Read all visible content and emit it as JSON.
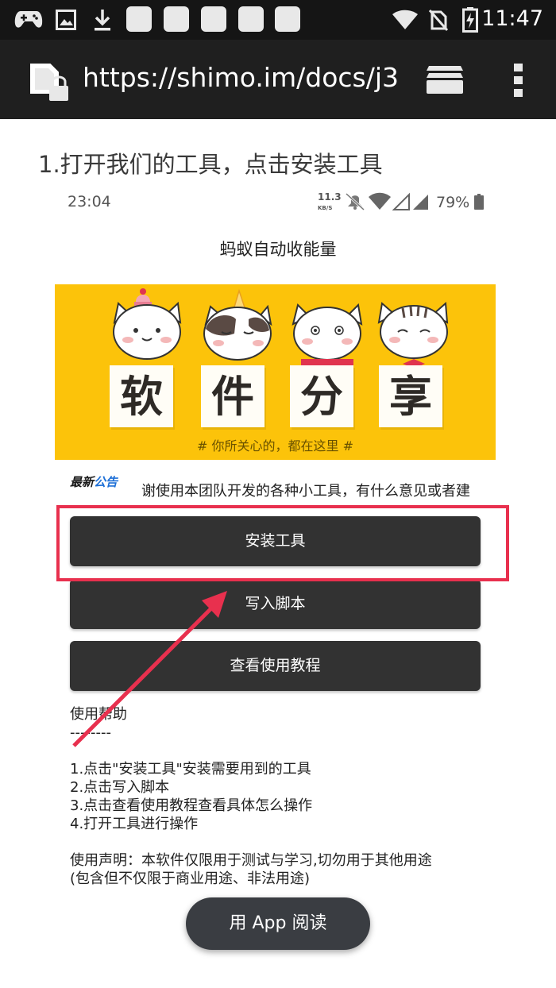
{
  "status_bar": {
    "time": "11:47",
    "icons": [
      "gamepad-icon",
      "image-icon",
      "download-icon",
      "app-placeholder-icon",
      "app-placeholder-icon",
      "app-placeholder-icon",
      "app-placeholder-icon",
      "app-placeholder-icon",
      "wifi-icon",
      "no-sim-icon",
      "battery-charging-icon"
    ]
  },
  "browser": {
    "url": "https://shimo.im/docs/j3",
    "icons": [
      "page-lock-icon",
      "tabs-icon",
      "more-vert-icon"
    ]
  },
  "doc": {
    "heading": "1.打开我们的工具，点击安装工具"
  },
  "screenshot": {
    "time": "23:04",
    "net_speed": "11.3",
    "net_unit": "KB/S",
    "battery": "79%",
    "title": "蚂蚁自动收能量",
    "banner": {
      "chars": [
        "软",
        "件",
        "分",
        "享"
      ],
      "tagline": "# 你所关心的，都在这里 #"
    },
    "notice": {
      "label_a": "最新",
      "label_b": "公告",
      "text": "谢使用本团队开发的各种小工具，有什么意见或者建"
    },
    "buttons": {
      "install": "安装工具",
      "write_script": "写入脚本",
      "tutorial": "查看使用教程"
    },
    "help": {
      "title": "使用帮助",
      "divider": "--------",
      "steps": [
        "1.点击\"安装工具\"安装需要用到的工具",
        "2.点击写入脚本",
        "3.点击查看使用教程查看具体怎么操作",
        "4.打开工具进行操作"
      ],
      "disclaimer_line1": "使用声明：本软件仅限用于测试与学习,切勿用于其他用途",
      "disclaimer_line2": "(包含但不仅限于商业用途、非法用途)"
    }
  },
  "fab": {
    "label": "用 App 阅读"
  },
  "colors": {
    "status_bar": "#151515",
    "url_bar": "#1f1f1f",
    "banner_yellow": "#fcc30a",
    "button_dark": "#323232",
    "highlight_red": "#e8304e",
    "fab_bg": "#3a3d42"
  }
}
